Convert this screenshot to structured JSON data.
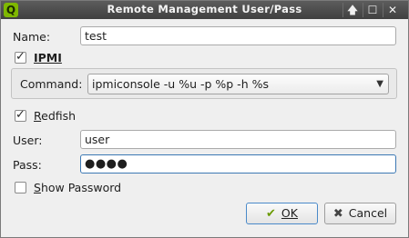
{
  "window": {
    "title": "Remote Management User/Pass",
    "app_icon": "Q",
    "controls": {
      "up": "🡅",
      "maximize": "☐",
      "close": "✕"
    }
  },
  "form": {
    "name_label": "Name:",
    "name_value": "test",
    "ipmi": {
      "label": "IPMI",
      "checked": true,
      "command_label": "Command:",
      "command_value": "ipmiconsole -u %u -p %p -h %s"
    },
    "redfish": {
      "label": "Redfish",
      "checked": true
    },
    "user_label": "User:",
    "user_value": "user",
    "pass_label": "Pass:",
    "pass_value": "●●●●",
    "show_password": {
      "label": "Show Password",
      "checked": false
    }
  },
  "buttons": {
    "ok_label": "OK",
    "cancel_label": "Cancel"
  },
  "colors": {
    "accent": "#3c79b4",
    "titlebar": "#404040",
    "app_icon": "#7fb800"
  },
  "icons": {
    "ok": "check-icon",
    "cancel": "x-icon"
  }
}
